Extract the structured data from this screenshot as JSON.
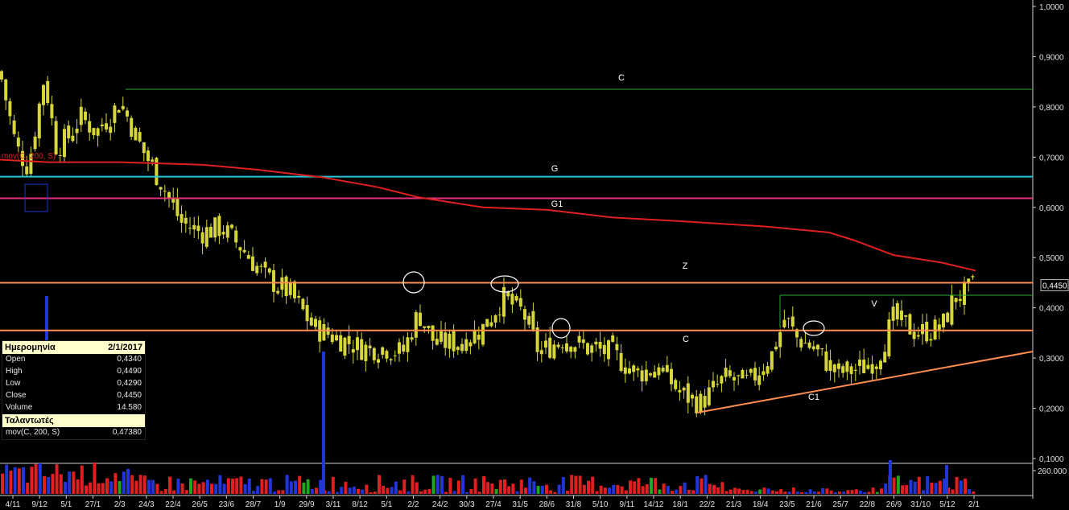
{
  "chart_data": {
    "type": "candlestick",
    "y_ticks": [
      "1,0000",
      "0,9000",
      "0,8000",
      "0,7000",
      "0,6000",
      "0,5000",
      "0,4000",
      "0,3000",
      "0,2000",
      "0,1000"
    ],
    "x_ticks": [
      "4/11",
      "9/12",
      "5/1",
      "27/1",
      "2/3",
      "24/3",
      "22/4",
      "26/5",
      "23/6",
      "28/7",
      "1/9",
      "29/9",
      "3/11",
      "8/12",
      "5/1",
      "2/2",
      "24/2",
      "30/3",
      "27/4",
      "31/5",
      "28/6",
      "31/8",
      "5/10",
      "9/11",
      "14/12",
      "18/1",
      "22/2",
      "21/3",
      "18/4",
      "23/5",
      "21/6",
      "25/7",
      "22/8",
      "26/9",
      "31/10",
      "5/12",
      "2/1"
    ],
    "ylim": [
      0.1,
      1.0
    ],
    "volume_tick": "260.000",
    "last_price_label": "0,4450",
    "moving_average_label": "mov(C, 200, S)",
    "horizontal_lines": [
      {
        "label": "C",
        "value": 0.835,
        "color": "#2faa2f"
      },
      {
        "label": "G",
        "value": 0.661,
        "color": "#26c6da"
      },
      {
        "label": "G1",
        "value": 0.618,
        "color": "#e0307a"
      },
      {
        "label": "Z",
        "value": 0.45,
        "color": "#ff8c50"
      },
      {
        "label": "C",
        "value": 0.355,
        "color": "#ff8c50"
      },
      {
        "label": "V",
        "value": 0.425,
        "color": "#2faa2f"
      }
    ],
    "trendline_label": "C1",
    "candle_color": "#d6d63a",
    "ma_color": "#e02020"
  },
  "info_panel": {
    "date_label": "Ημερομηνία",
    "date_value": "2/1/2017",
    "rows": [
      {
        "label": "Open",
        "value": "0,4340"
      },
      {
        "label": "High",
        "value": "0,4490"
      },
      {
        "label": "Low",
        "value": "0,4290"
      },
      {
        "label": "Close",
        "value": "0,4450"
      },
      {
        "label": "Volume",
        "value": "14.580"
      }
    ],
    "indicators_header": "Ταλαντωτές",
    "indicator_label": "mov(C, 200, S)",
    "indicator_value": "0,47380"
  }
}
